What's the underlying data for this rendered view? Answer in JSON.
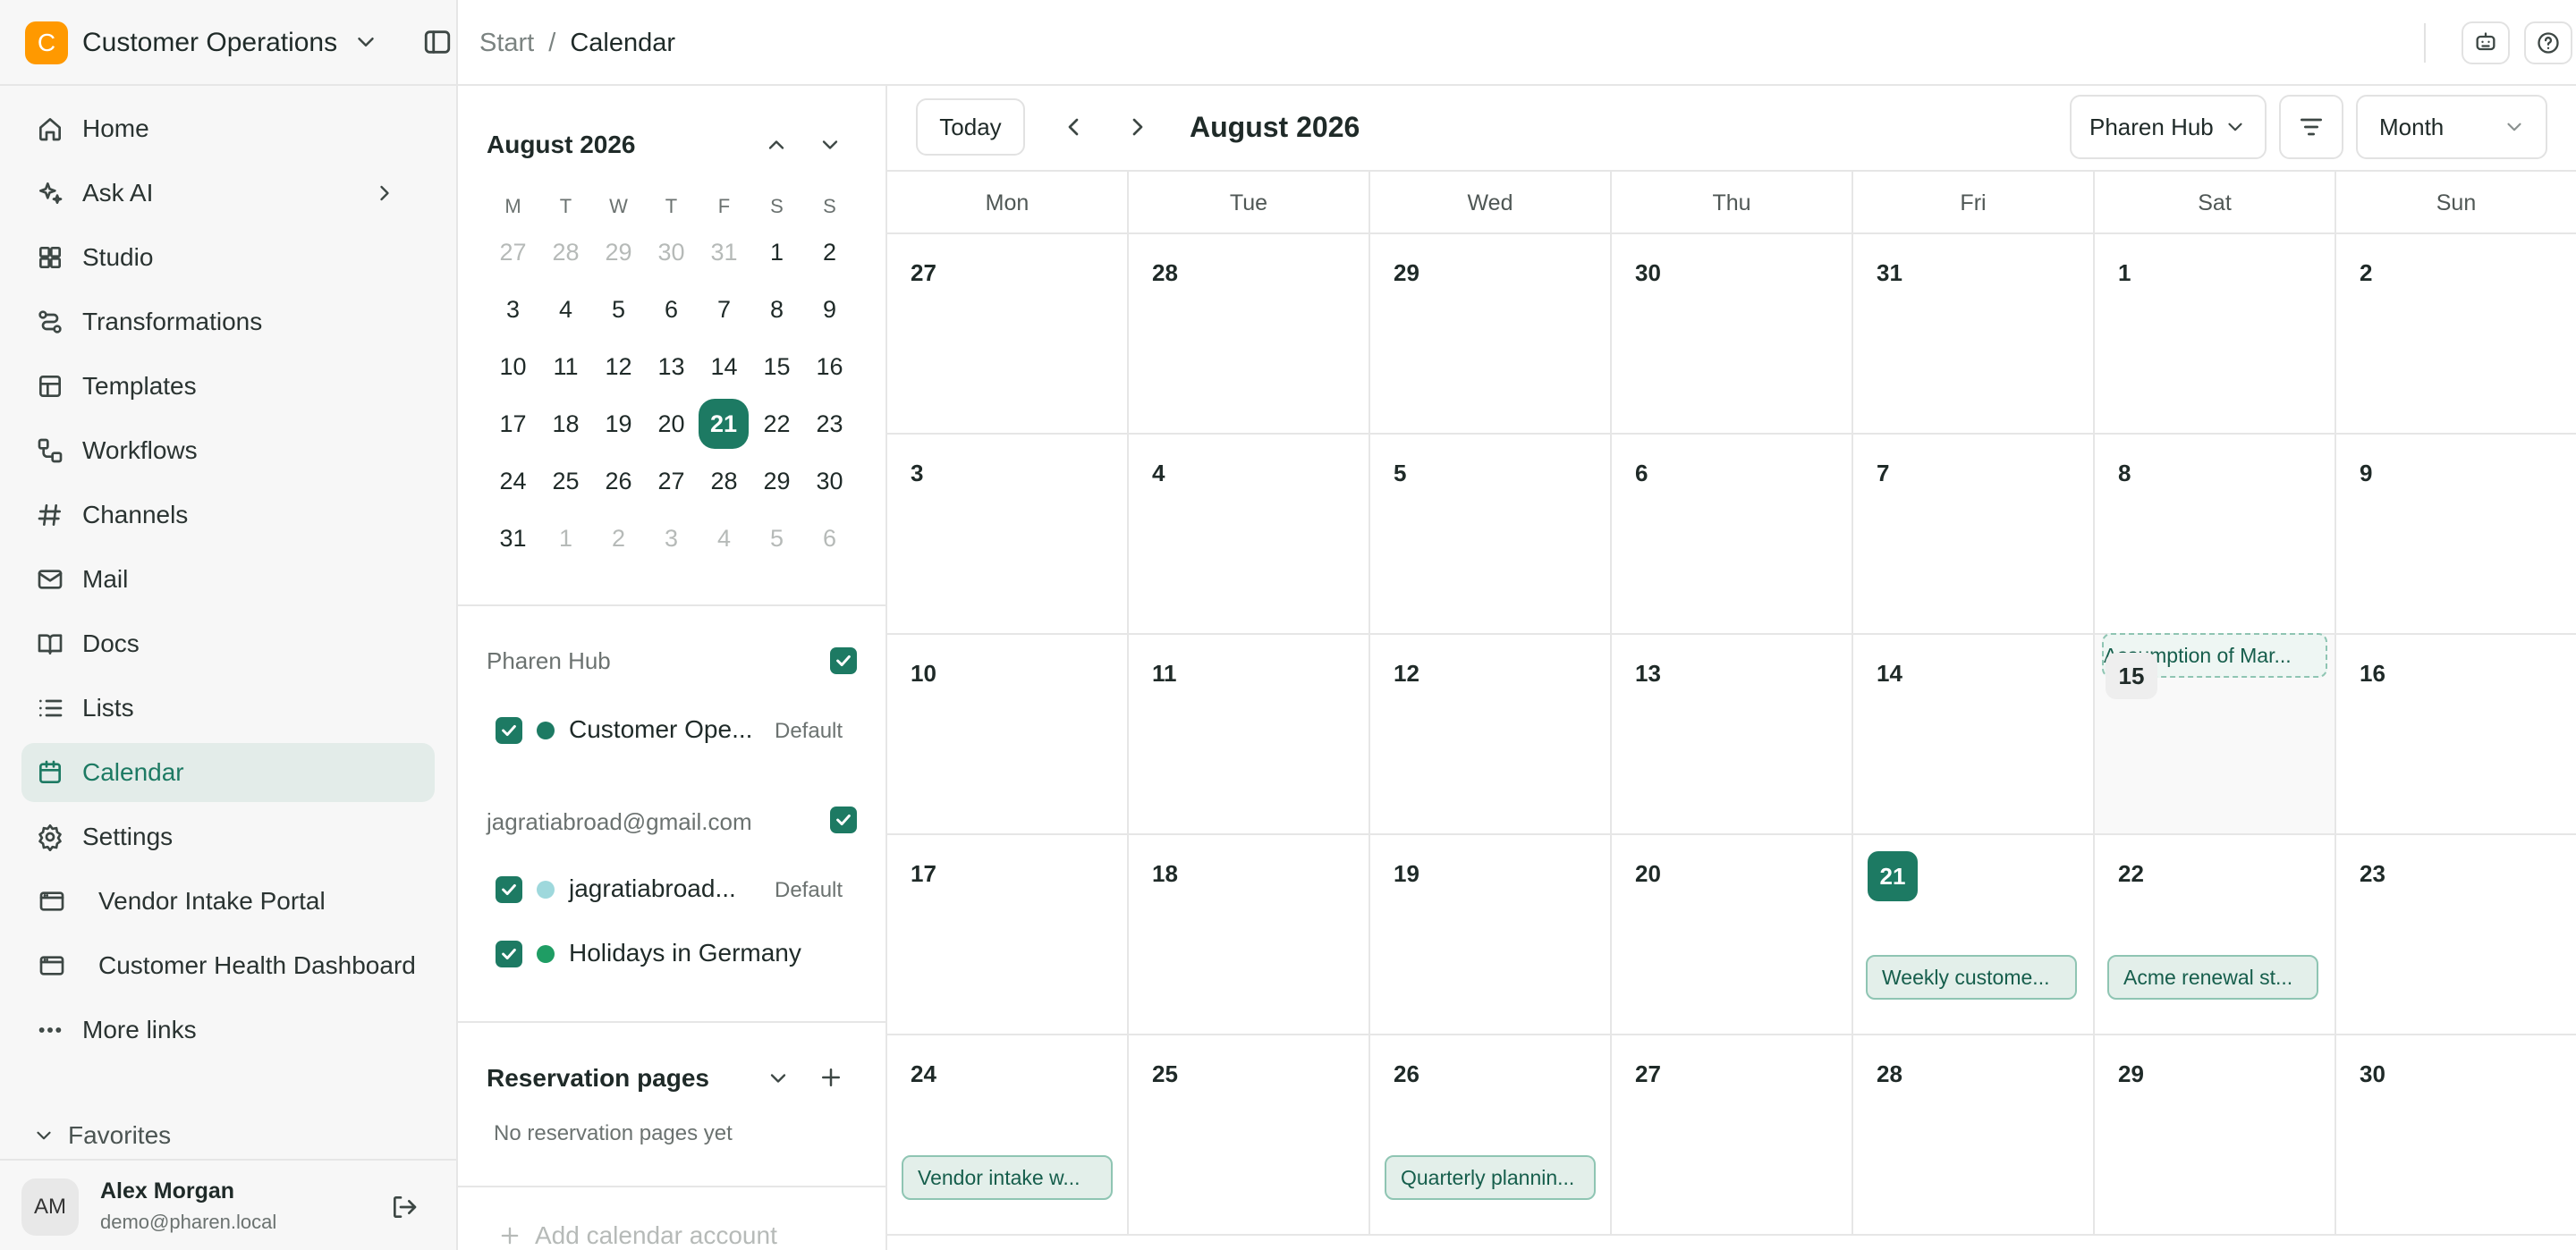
{
  "workspace": {
    "badge": "C",
    "name": "Customer Operations"
  },
  "breadcrumb": {
    "root": "Start",
    "separator": "/",
    "current": "Calendar"
  },
  "sidebar": {
    "items": [
      {
        "label": "Home",
        "icon": "home-icon"
      },
      {
        "label": "Ask AI",
        "icon": "sparkles-icon"
      },
      {
        "label": "Studio",
        "icon": "grid-icon"
      },
      {
        "label": "Transformations",
        "icon": "flow-icon"
      },
      {
        "label": "Templates",
        "icon": "template-icon"
      },
      {
        "label": "Workflows",
        "icon": "workflow-icon"
      },
      {
        "label": "Channels",
        "icon": "hash-icon"
      },
      {
        "label": "Mail",
        "icon": "mail-icon"
      },
      {
        "label": "Docs",
        "icon": "book-icon"
      },
      {
        "label": "Lists",
        "icon": "list-icon"
      },
      {
        "label": "Calendar",
        "icon": "calendar-icon",
        "active": true
      },
      {
        "label": "Settings",
        "icon": "gear-icon"
      },
      {
        "label": "Vendor Intake Portal",
        "icon": "browser-icon"
      },
      {
        "label": "Customer Health Dashboard",
        "icon": "browser-icon"
      },
      {
        "label": "More links",
        "icon": "more-icon"
      }
    ],
    "favorites_label": "Favorites",
    "user": {
      "initials": "AM",
      "name": "Alex Morgan",
      "email": "demo@pharen.local"
    }
  },
  "mini_calendar": {
    "title": "August 2026",
    "weekdays": [
      "M",
      "T",
      "W",
      "T",
      "F",
      "S",
      "S"
    ],
    "weeks": [
      [
        "27",
        "28",
        "29",
        "30",
        "31",
        "1",
        "2"
      ],
      [
        "3",
        "4",
        "5",
        "6",
        "7",
        "8",
        "9"
      ],
      [
        "10",
        "11",
        "12",
        "13",
        "14",
        "15",
        "16"
      ],
      [
        "17",
        "18",
        "19",
        "20",
        "21",
        "22",
        "23"
      ],
      [
        "24",
        "25",
        "26",
        "27",
        "28",
        "29",
        "30"
      ],
      [
        "31",
        "1",
        "2",
        "3",
        "4",
        "5",
        "6"
      ]
    ],
    "selected": "21"
  },
  "calendar_sources": {
    "pharen_hub": {
      "label": "Pharen Hub",
      "calendars": [
        {
          "name": "Customer Ope...",
          "tag": "Default",
          "color": "#1d7a63"
        }
      ]
    },
    "gmail": {
      "label": "jagratiabroad@gmail.com",
      "calendars": [
        {
          "name": "jagratiabroad...",
          "tag": "Default",
          "color": "#9ed8dc"
        },
        {
          "name": "Holidays in Germany",
          "tag": "",
          "color": "#1f9d64"
        }
      ]
    }
  },
  "reservation": {
    "title": "Reservation pages",
    "empty": "No reservation pages yet",
    "add_account": "Add calendar account"
  },
  "toolbar": {
    "today": "Today",
    "title": "August 2026",
    "calendar_select": "Pharen Hub",
    "view_select": "Month"
  },
  "month": {
    "weekdays": [
      "Mon",
      "Tue",
      "Wed",
      "Thu",
      "Fri",
      "Sat",
      "Sun"
    ],
    "weeks": [
      [
        "27",
        "28",
        "29",
        "30",
        "31",
        "1",
        "2"
      ],
      [
        "3",
        "4",
        "5",
        "6",
        "7",
        "8",
        "9"
      ],
      [
        "10",
        "11",
        "12",
        "13",
        "14",
        "15",
        "16"
      ],
      [
        "17",
        "18",
        "19",
        "20",
        "21",
        "22",
        "23"
      ],
      [
        "24",
        "25",
        "26",
        "27",
        "28",
        "29",
        "30"
      ]
    ],
    "today": "21",
    "events": [
      {
        "title": "Assumption of Mar...",
        "week": 2,
        "day": 5,
        "style": "dashed"
      },
      {
        "title": "Weekly custome...",
        "week": 3,
        "day": 4
      },
      {
        "title": "Acme renewal st...",
        "week": 3,
        "day": 5
      },
      {
        "title": "Vendor intake w...",
        "week": 4,
        "day": 0
      },
      {
        "title": "Quarterly plannin...",
        "week": 4,
        "day": 2
      }
    ]
  },
  "colors": {
    "accent": "#1d7a63",
    "workspace_badge": "#ff9900",
    "event_bg": "#e3efea",
    "event_border": "#8fc5b3"
  }
}
